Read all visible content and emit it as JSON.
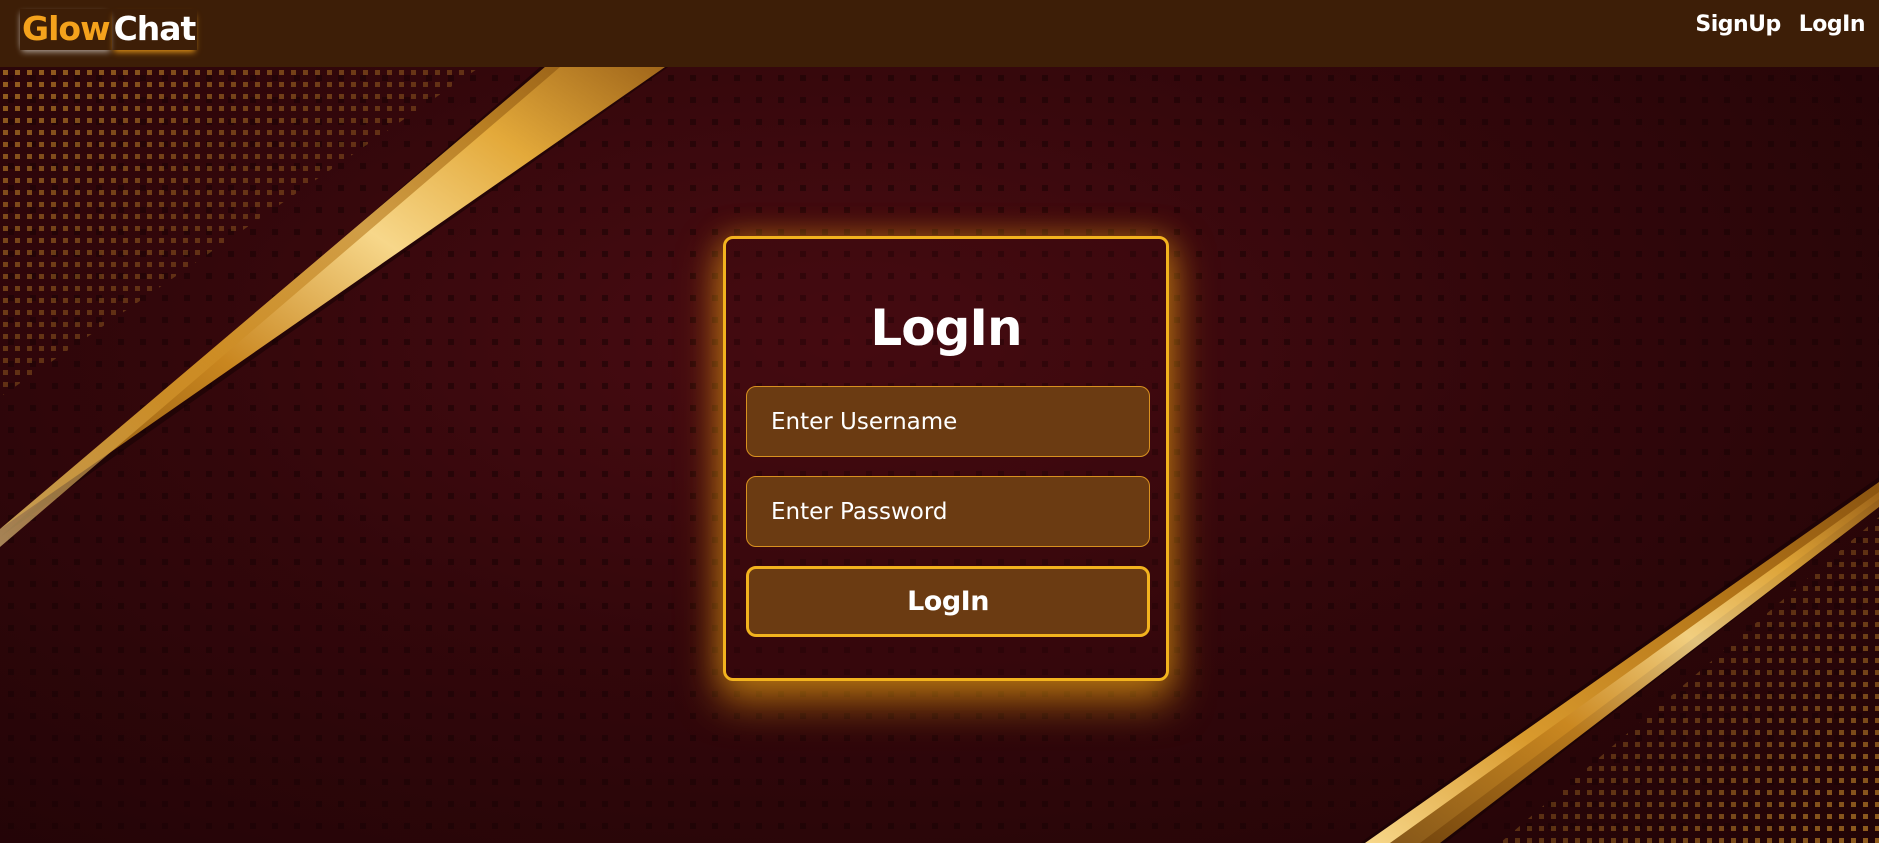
{
  "navbar": {
    "logo_part1": "Glow",
    "logo_part2": "Chat",
    "links": [
      {
        "label": "SignUp"
      },
      {
        "label": "LogIn"
      }
    ]
  },
  "login_form": {
    "title": "LogIn",
    "username_placeholder": "Enter Username",
    "username_value": "",
    "password_placeholder": "Enter Password",
    "password_value": "",
    "submit_label": "LogIn"
  },
  "colors": {
    "navbar_bg": "#3d1e07",
    "accent_gold": "#f2b31e",
    "logo_glow": "#f4a21c",
    "field_bg": "#6b3b12",
    "page_bg": "#33070b"
  }
}
